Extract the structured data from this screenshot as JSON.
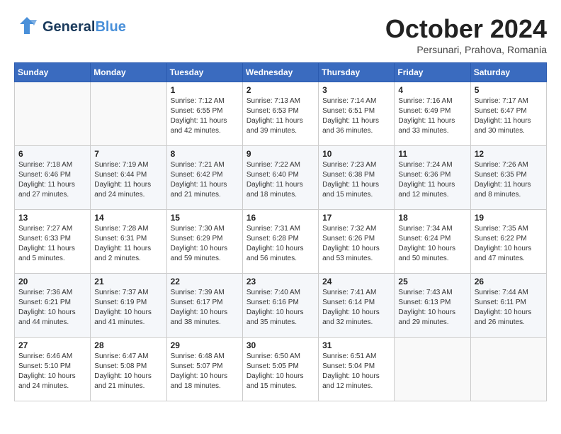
{
  "header": {
    "logo": {
      "general": "General",
      "blue": "Blue",
      "bird_symbol": "🐦"
    },
    "month_title": "October 2024",
    "location": "Persunari, Prahova, Romania"
  },
  "weekdays": [
    "Sunday",
    "Monday",
    "Tuesday",
    "Wednesday",
    "Thursday",
    "Friday",
    "Saturday"
  ],
  "weeks": [
    [
      {
        "day": "",
        "info": ""
      },
      {
        "day": "",
        "info": ""
      },
      {
        "day": "1",
        "info": "Sunrise: 7:12 AM\nSunset: 6:55 PM\nDaylight: 11 hours and 42 minutes."
      },
      {
        "day": "2",
        "info": "Sunrise: 7:13 AM\nSunset: 6:53 PM\nDaylight: 11 hours and 39 minutes."
      },
      {
        "day": "3",
        "info": "Sunrise: 7:14 AM\nSunset: 6:51 PM\nDaylight: 11 hours and 36 minutes."
      },
      {
        "day": "4",
        "info": "Sunrise: 7:16 AM\nSunset: 6:49 PM\nDaylight: 11 hours and 33 minutes."
      },
      {
        "day": "5",
        "info": "Sunrise: 7:17 AM\nSunset: 6:47 PM\nDaylight: 11 hours and 30 minutes."
      }
    ],
    [
      {
        "day": "6",
        "info": "Sunrise: 7:18 AM\nSunset: 6:46 PM\nDaylight: 11 hours and 27 minutes."
      },
      {
        "day": "7",
        "info": "Sunrise: 7:19 AM\nSunset: 6:44 PM\nDaylight: 11 hours and 24 minutes."
      },
      {
        "day": "8",
        "info": "Sunrise: 7:21 AM\nSunset: 6:42 PM\nDaylight: 11 hours and 21 minutes."
      },
      {
        "day": "9",
        "info": "Sunrise: 7:22 AM\nSunset: 6:40 PM\nDaylight: 11 hours and 18 minutes."
      },
      {
        "day": "10",
        "info": "Sunrise: 7:23 AM\nSunset: 6:38 PM\nDaylight: 11 hours and 15 minutes."
      },
      {
        "day": "11",
        "info": "Sunrise: 7:24 AM\nSunset: 6:36 PM\nDaylight: 11 hours and 12 minutes."
      },
      {
        "day": "12",
        "info": "Sunrise: 7:26 AM\nSunset: 6:35 PM\nDaylight: 11 hours and 8 minutes."
      }
    ],
    [
      {
        "day": "13",
        "info": "Sunrise: 7:27 AM\nSunset: 6:33 PM\nDaylight: 11 hours and 5 minutes."
      },
      {
        "day": "14",
        "info": "Sunrise: 7:28 AM\nSunset: 6:31 PM\nDaylight: 11 hours and 2 minutes."
      },
      {
        "day": "15",
        "info": "Sunrise: 7:30 AM\nSunset: 6:29 PM\nDaylight: 10 hours and 59 minutes."
      },
      {
        "day": "16",
        "info": "Sunrise: 7:31 AM\nSunset: 6:28 PM\nDaylight: 10 hours and 56 minutes."
      },
      {
        "day": "17",
        "info": "Sunrise: 7:32 AM\nSunset: 6:26 PM\nDaylight: 10 hours and 53 minutes."
      },
      {
        "day": "18",
        "info": "Sunrise: 7:34 AM\nSunset: 6:24 PM\nDaylight: 10 hours and 50 minutes."
      },
      {
        "day": "19",
        "info": "Sunrise: 7:35 AM\nSunset: 6:22 PM\nDaylight: 10 hours and 47 minutes."
      }
    ],
    [
      {
        "day": "20",
        "info": "Sunrise: 7:36 AM\nSunset: 6:21 PM\nDaylight: 10 hours and 44 minutes."
      },
      {
        "day": "21",
        "info": "Sunrise: 7:37 AM\nSunset: 6:19 PM\nDaylight: 10 hours and 41 minutes."
      },
      {
        "day": "22",
        "info": "Sunrise: 7:39 AM\nSunset: 6:17 PM\nDaylight: 10 hours and 38 minutes."
      },
      {
        "day": "23",
        "info": "Sunrise: 7:40 AM\nSunset: 6:16 PM\nDaylight: 10 hours and 35 minutes."
      },
      {
        "day": "24",
        "info": "Sunrise: 7:41 AM\nSunset: 6:14 PM\nDaylight: 10 hours and 32 minutes."
      },
      {
        "day": "25",
        "info": "Sunrise: 7:43 AM\nSunset: 6:13 PM\nDaylight: 10 hours and 29 minutes."
      },
      {
        "day": "26",
        "info": "Sunrise: 7:44 AM\nSunset: 6:11 PM\nDaylight: 10 hours and 26 minutes."
      }
    ],
    [
      {
        "day": "27",
        "info": "Sunrise: 6:46 AM\nSunset: 5:10 PM\nDaylight: 10 hours and 24 minutes."
      },
      {
        "day": "28",
        "info": "Sunrise: 6:47 AM\nSunset: 5:08 PM\nDaylight: 10 hours and 21 minutes."
      },
      {
        "day": "29",
        "info": "Sunrise: 6:48 AM\nSunset: 5:07 PM\nDaylight: 10 hours and 18 minutes."
      },
      {
        "day": "30",
        "info": "Sunrise: 6:50 AM\nSunset: 5:05 PM\nDaylight: 10 hours and 15 minutes."
      },
      {
        "day": "31",
        "info": "Sunrise: 6:51 AM\nSunset: 5:04 PM\nDaylight: 10 hours and 12 minutes."
      },
      {
        "day": "",
        "info": ""
      },
      {
        "day": "",
        "info": ""
      }
    ]
  ]
}
